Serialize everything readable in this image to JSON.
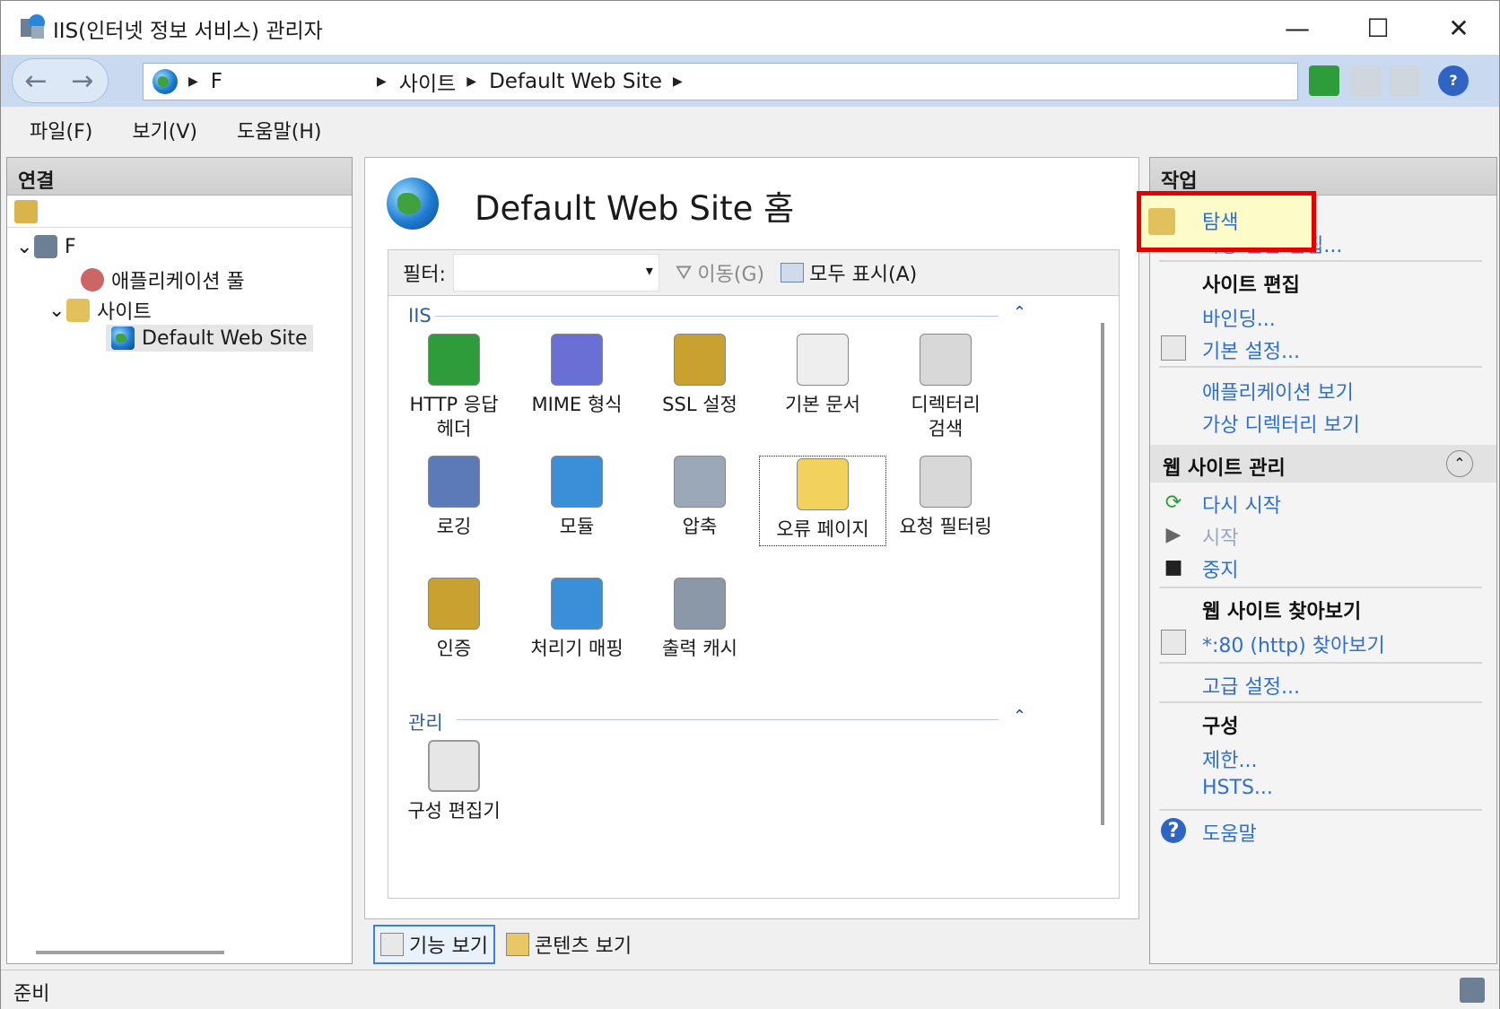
{
  "window": {
    "title": "IIS(인터넷 정보 서비스) 관리자",
    "minimize": "—",
    "maximize": "☐",
    "close": "✕"
  },
  "address": {
    "server": "F",
    "segment1": "사이트",
    "segment2": "Default Web Site"
  },
  "menu": {
    "file": "파일(F)",
    "view": "보기(V)",
    "help": "도움말(H)"
  },
  "connections": {
    "header": "연결",
    "server_node": "F",
    "app_pools": "애플리케이션 풀",
    "sites": "사이트",
    "default_site": "Default Web Site"
  },
  "center": {
    "title": "Default Web Site 홈",
    "filter_label": "필터:",
    "go_button": "이동(G)",
    "show_all": "모두 표시(A)",
    "group_iis": "IIS",
    "group_manage": "관리",
    "features": [
      {
        "label1": "HTTP 응답",
        "label2": "헤더"
      },
      {
        "label1": "MIME 형식",
        "label2": ""
      },
      {
        "label1": "SSL 설정",
        "label2": ""
      },
      {
        "label1": "기본 문서",
        "label2": ""
      },
      {
        "label1": "디렉터리",
        "label2": "검색"
      },
      {
        "label1": "로깅",
        "label2": ""
      },
      {
        "label1": "모듈",
        "label2": ""
      },
      {
        "label1": "압축",
        "label2": ""
      },
      {
        "label1": "오류 페이지",
        "label2": ""
      },
      {
        "label1": "요청 필터링",
        "label2": ""
      },
      {
        "label1": "인증",
        "label2": ""
      },
      {
        "label1": "처리기 매핑",
        "label2": ""
      },
      {
        "label1": "출력 캐시",
        "label2": ""
      }
    ],
    "config_editor": "구성 편집기",
    "tab_features": "기능 보기",
    "tab_content": "콘텐츠 보기"
  },
  "actions": {
    "header": "작업",
    "explore": "탐색",
    "edit_permissions": "사용 권한 편집...",
    "edit_site_header": "사이트 편집",
    "bindings": "바인딩...",
    "basic_settings": "기본 설정...",
    "view_applications": "애플리케이션 보기",
    "view_virtual_dirs": "가상 디렉터리 보기",
    "manage_header": "웹 사이트 관리",
    "restart": "다시 시작",
    "start": "시작",
    "stop": "중지",
    "browse_header": "웹 사이트 찾아보기",
    "browse_80": "*:80 (http) 찾아보기",
    "advanced": "고급 설정...",
    "config_header": "구성",
    "limits": "제한...",
    "hsts": "HSTS...",
    "help": "도움말"
  },
  "status": {
    "text": "준비"
  },
  "colors": {
    "accent": "#2e6fd0",
    "highlight": "#e60000",
    "addressbar": "#c9daf0"
  }
}
